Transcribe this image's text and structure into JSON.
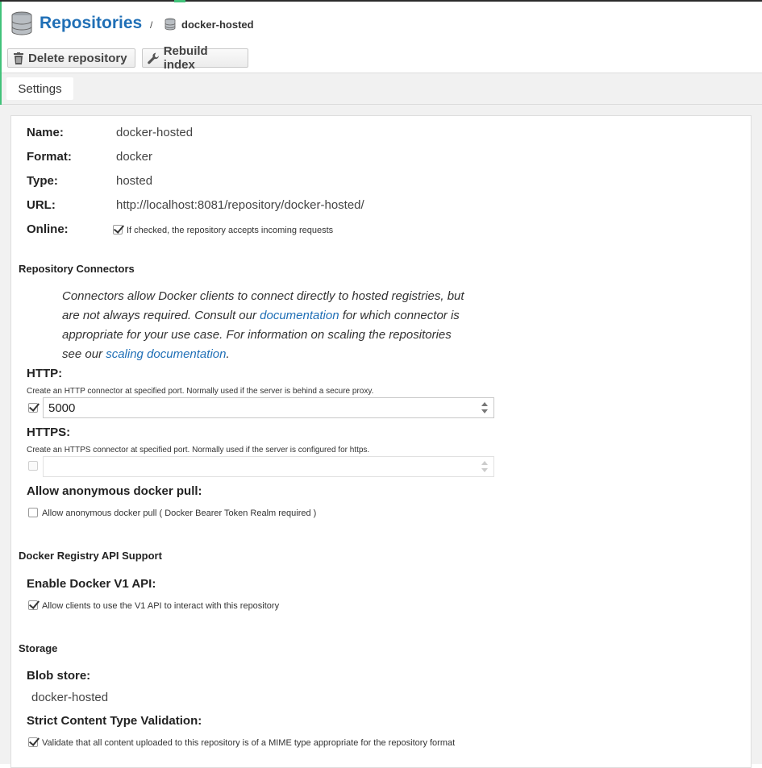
{
  "breadcrumb": {
    "title": "Repositories",
    "separator": "/",
    "current": "docker-hosted"
  },
  "toolbar": {
    "delete_label": "Delete repository",
    "rebuild_label": "Rebuild index"
  },
  "tabs": [
    {
      "label": "Settings"
    }
  ],
  "summary": {
    "name_label": "Name:",
    "name_value": "docker-hosted",
    "format_label": "Format:",
    "format_value": "docker",
    "type_label": "Type:",
    "type_value": "hosted",
    "url_label": "URL:",
    "url_value": "http://localhost:8081/repository/docker-hosted/",
    "online_label": "Online:",
    "online_text": "If checked, the repository accepts incoming requests",
    "online_checked": true
  },
  "connectors": {
    "section_title": "Repository Connectors",
    "note_part1": "Connectors allow Docker clients to connect directly to hosted registries, but are not always required. Consult our ",
    "note_link1": "documentation",
    "note_part2": " for which connector is appropriate for your use case. For information on scaling the repositories see our ",
    "note_link2": "scaling documentation",
    "note_part3": ".",
    "http_label": "HTTP:",
    "http_help": "Create an HTTP connector at specified port. Normally used if the server is behind a secure proxy.",
    "http_checked": true,
    "http_value": "5000",
    "https_label": "HTTPS:",
    "https_help": "Create an HTTPS connector at specified port. Normally used if the server is configured for https.",
    "https_checked": false,
    "https_value": "",
    "anon_label": "Allow anonymous docker pull:",
    "anon_text": "Allow anonymous docker pull ( Docker Bearer Token Realm required )",
    "anon_checked": false
  },
  "docker_api": {
    "section_title": "Docker Registry API Support",
    "v1_label": "Enable Docker V1 API:",
    "v1_text": "Allow clients to use the V1 API to interact with this repository",
    "v1_checked": true
  },
  "storage": {
    "section_title": "Storage",
    "blob_label": "Blob store:",
    "blob_value": "docker-hosted",
    "strict_label": "Strict Content Type Validation:",
    "strict_text": "Validate that all content uploaded to this repository is of a MIME type appropriate for the repository format",
    "strict_checked": true
  },
  "colors": {
    "link": "#1f6fb6",
    "accent": "#41c27a"
  },
  "icons": {
    "repositories": "database-icon",
    "delete": "trash-icon",
    "rebuild": "wrench-icon"
  }
}
